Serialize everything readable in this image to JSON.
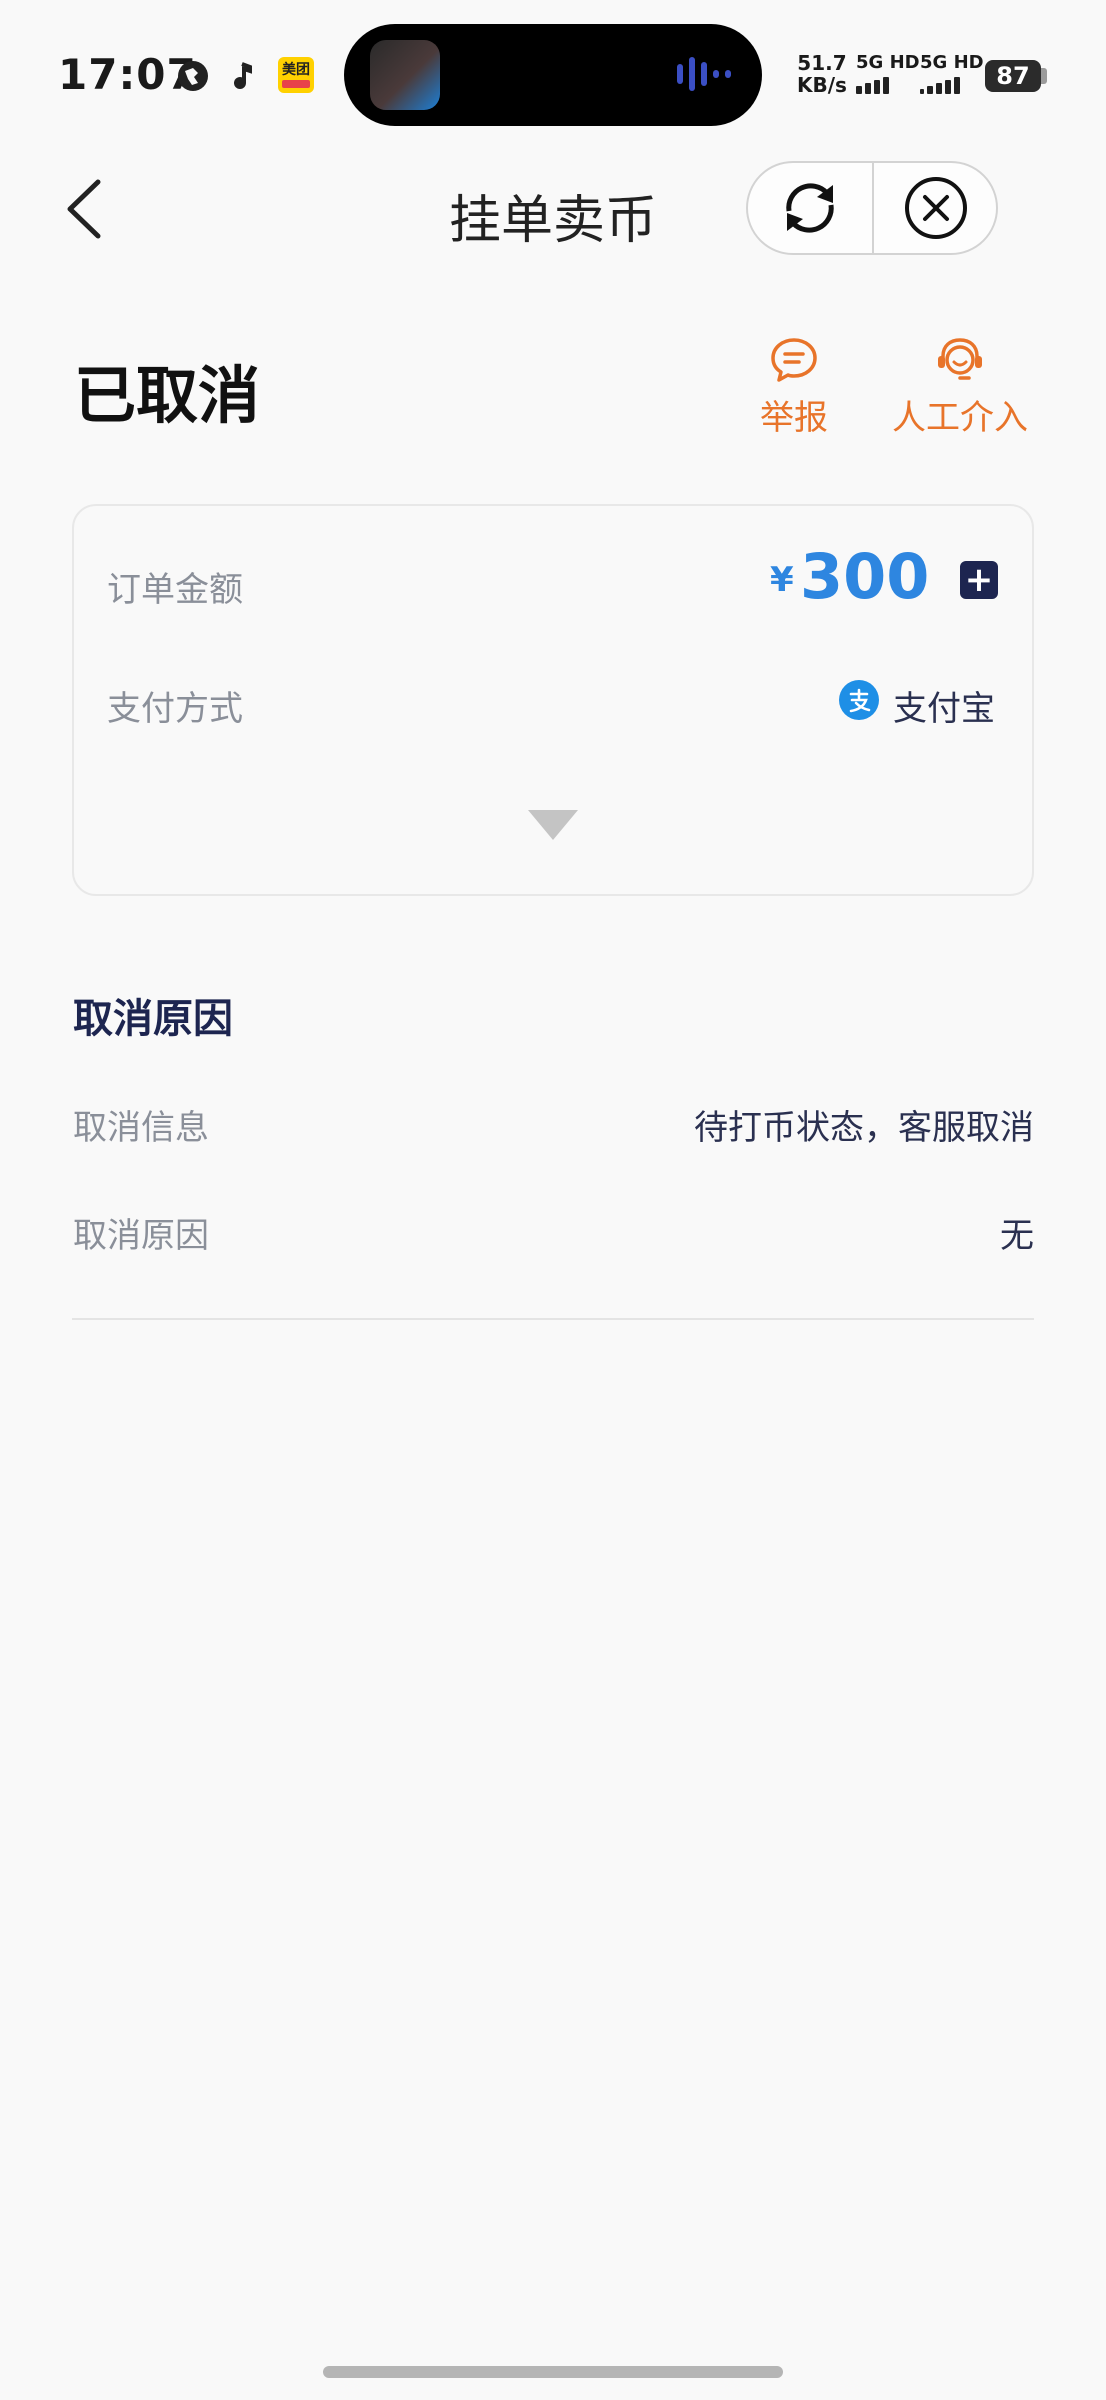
{
  "status_bar": {
    "time": "17:07",
    "app_badge_label": "美团",
    "net_speed_value": "51.7",
    "net_speed_unit": "KB/s",
    "sim1": "5G HD",
    "sim2": "5G HD",
    "battery": "87"
  },
  "header": {
    "title": "挂单卖币"
  },
  "order": {
    "status": "已取消",
    "report_label": "举报",
    "intervene_label": "人工介入"
  },
  "summary_card": {
    "amount_label": "订单金额",
    "currency_symbol": "¥",
    "amount": "300",
    "payment_label": "支付方式",
    "payment_method": "支付宝"
  },
  "cancel_section": {
    "title": "取消原因",
    "rows": [
      {
        "label": "取消信息",
        "value": "待打币状态，客服取消"
      },
      {
        "label": "取消原因",
        "value": "无"
      }
    ]
  },
  "colors": {
    "accent_orange": "#e8742a",
    "amount_blue": "#2e86e0",
    "navy": "#1d2550",
    "alipay_blue": "#1e8fe6"
  }
}
